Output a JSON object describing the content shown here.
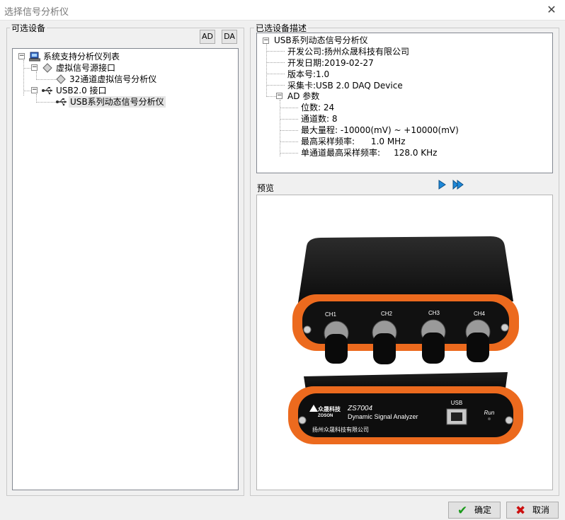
{
  "window": {
    "title": "选择信号分析仪"
  },
  "left_panel": {
    "label": "可选设备",
    "ad_button": "AD",
    "da_button": "DA",
    "tree": {
      "root": "系统支持分析仪列表",
      "virtual_group": "虚拟信号源接口",
      "virtual_item": "32通道虚拟信号分析仪",
      "usb_group": "USB2.0 接口",
      "usb_item": "USB系列动态信号分析仪"
    }
  },
  "right_panel": {
    "label": "已选设备描述",
    "desc": {
      "root": "USB系列动态信号分析仪",
      "company": "开发公司:扬州众晟科技有限公司",
      "date": "开发日期:2019-02-27",
      "version": "版本号:1.0",
      "card": "采集卡:USB 2.0 DAQ Device",
      "ad_group": "AD 参数",
      "bits": "位数: 24",
      "channels": "通道数: 8",
      "range": "最大量程: -10000(mV) ~ +10000(mV)",
      "max_rate": "最高采样频率:      1.0 MHz",
      "single_rate": "单通道最高采样频率:     128.0 KHz"
    },
    "preview_label": "预览",
    "device": {
      "ch1": "CH1",
      "ch2": "CH2",
      "ch3": "CH3",
      "ch4": "CH4",
      "brand_cn": "众晟科技",
      "brand_en": "ZOSON",
      "model": "ZS7004",
      "product": "Dynamic Signal Analyzer",
      "company": "扬州众晟科技有限公司",
      "usb": "USB",
      "run": "Run"
    }
  },
  "buttons": {
    "ok": "确定",
    "cancel": "取消"
  },
  "colors": {
    "accent_blue": "#1e88d8",
    "ok_green": "#1a9a1a",
    "cancel_red": "#cc1010",
    "device_orange": "#ec6a1e"
  }
}
